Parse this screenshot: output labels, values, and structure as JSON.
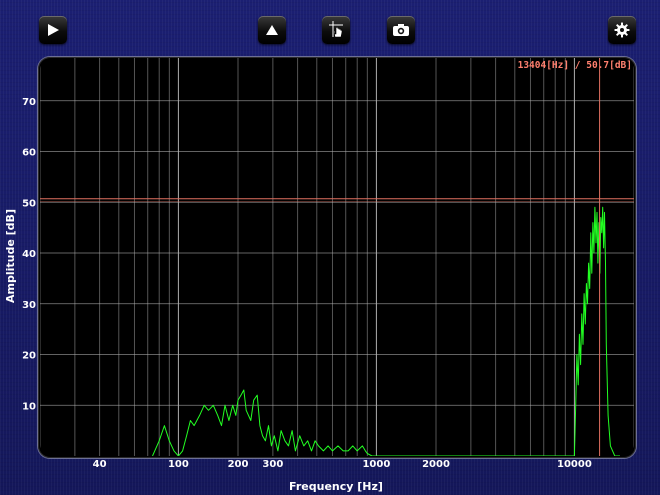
{
  "toolbar": {
    "buttons": [
      {
        "name": "play-button",
        "icon": "play-icon"
      },
      {
        "name": "peak-up-button",
        "icon": "triangle-up-icon"
      },
      {
        "name": "cursor-tool-button",
        "icon": "hand-cursor-icon"
      },
      {
        "name": "screenshot-button",
        "icon": "camera-icon"
      },
      {
        "name": "settings-button",
        "icon": "gear-icon"
      }
    ]
  },
  "readout": "13404[Hz] / 50.7[dB]",
  "colors": {
    "trace": "#22ff22",
    "cursor": "#e07060",
    "grid_major": "#b0b0b0",
    "grid_minor": "#555555",
    "background": "#15185e"
  },
  "chart_data": {
    "type": "line",
    "xscale": "log",
    "xlabel": "Frequency [Hz]",
    "ylabel": "Amplitude [dB]",
    "xlim": [
      20,
      20000
    ],
    "ylim": [
      0,
      80
    ],
    "xticks": [
      40,
      100,
      200,
      300,
      1000,
      2000,
      10000
    ],
    "xtick_labels": [
      "40",
      "100",
      "200",
      "300",
      "1000",
      "2000",
      "10000"
    ],
    "yticks": [
      10,
      20,
      30,
      40,
      50,
      60,
      70
    ],
    "ytick_labels": [
      "10",
      "20",
      "30",
      "40",
      "50",
      "60",
      "70"
    ],
    "cursor": {
      "x": 13404,
      "y": 50.7
    },
    "series": [
      {
        "x": [
          74,
          80,
          85,
          90,
          95,
          100,
          105,
          110,
          115,
          120,
          128,
          135,
          142,
          150,
          158,
          165,
          172,
          180,
          188,
          195,
          200,
          207,
          214,
          220,
          226,
          232,
          240,
          250,
          258,
          266,
          275,
          285,
          295,
          305,
          318,
          330,
          345,
          360,
          375,
          390,
          410,
          430,
          450,
          470,
          490,
          510,
          540,
          570,
          600,
          640,
          680,
          720,
          760,
          800,
          850,
          880,
          900,
          950,
          1000,
          1100,
          1300,
          1500,
          10000,
          10150,
          10300,
          10450,
          10600,
          10750,
          10900,
          11050,
          11200,
          11350,
          11500,
          11650,
          11800,
          11950,
          12100,
          12250,
          12400,
          12550,
          12700,
          12850,
          13000,
          13150,
          13300,
          13450,
          13600,
          13750,
          13900,
          14050,
          14200,
          14350,
          14500,
          14800,
          15200,
          16000,
          17000
        ],
        "y": [
          0,
          3,
          6,
          3,
          1,
          0,
          1,
          4,
          7,
          6,
          8,
          10,
          9,
          10,
          8,
          6,
          10,
          7,
          10,
          8,
          11,
          12,
          13,
          9,
          8,
          7,
          11,
          12,
          6,
          4,
          3,
          6,
          2,
          4,
          1,
          5,
          3,
          2,
          5,
          1,
          4,
          2,
          3,
          1,
          3,
          2,
          1,
          2,
          1,
          2,
          1,
          1,
          2,
          1,
          2,
          1,
          0.5,
          0,
          0,
          0,
          0,
          0,
          0,
          10,
          20,
          14,
          24,
          18,
          28,
          22,
          32,
          26,
          34,
          30,
          38,
          33,
          44,
          36,
          46,
          40,
          49,
          42,
          48,
          38,
          46,
          36,
          47,
          44,
          49,
          41,
          48,
          38,
          22,
          8,
          2,
          0,
          0
        ]
      }
    ]
  }
}
